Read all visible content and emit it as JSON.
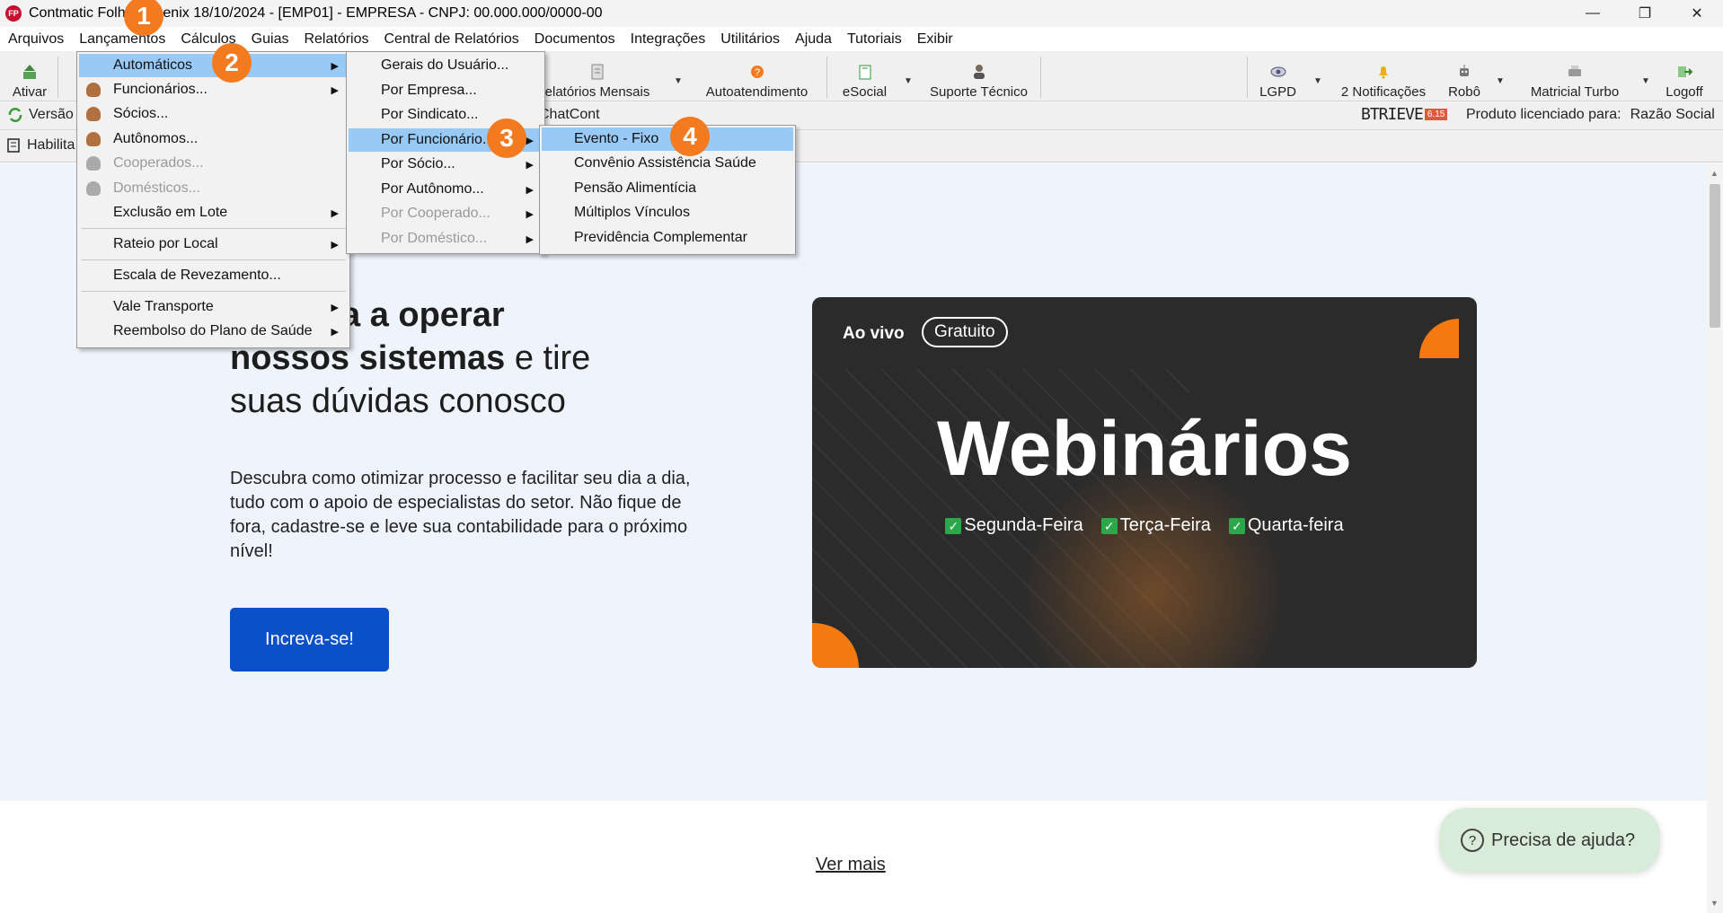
{
  "window": {
    "logo_text": "FP",
    "title": "Contmatic Folha Phoenix 18/10/2024 - [EMP01] - EMPRESA - CNPJ: 00.000.000/0000-00",
    "minimize": "—",
    "maximize": "❐",
    "close": "✕"
  },
  "menubar": [
    "Arquivos",
    "Lançamentos",
    "Cálculos",
    "Guias",
    "Relatórios",
    "Central de Relatórios",
    "Documentos",
    "Integrações",
    "Utilitários",
    "Ajuda",
    "Tutoriais",
    "Exibir"
  ],
  "toolbar": {
    "ativar": "Ativar",
    "relatorios_mensais": "elatórios Mensais",
    "autoatendimento": "Autoatendimento",
    "esocial": "eSocial",
    "suporte": "Suporte Técnico",
    "lgpd": "LGPD",
    "notificacoes": "2 Notificações",
    "robo": "Robô",
    "matricial": "Matricial Turbo",
    "logoff": "Logoff"
  },
  "bar2": {
    "versao": "Versão",
    "chatcont": "ChatCont",
    "btrieve": "BTRIEVE",
    "btrieve_ver": "6.15",
    "licenciado": "Produto licenciado para:",
    "razao": "Razão Social"
  },
  "bar3": {
    "habilita": "Habilita"
  },
  "menu_lancamentos": [
    {
      "label": "Automáticos",
      "state": "selected",
      "submenu": true
    },
    {
      "label": "Funcionários...",
      "icon": "person-icon",
      "submenu": true
    },
    {
      "label": "Sócios...",
      "icon": "person-icon"
    },
    {
      "label": "Autônomos...",
      "icon": "person-icon"
    },
    {
      "label": "Cooperados...",
      "icon": "person-icon",
      "state": "disabled"
    },
    {
      "label": "Domésticos...",
      "icon": "person-icon",
      "state": "disabled"
    },
    {
      "label": "Exclusão em Lote",
      "submenu": true
    },
    {
      "label": "Rateio por Local",
      "submenu": true
    },
    {
      "label": "Escala de Revezamento..."
    },
    {
      "label": "Vale Transporte",
      "submenu": true
    },
    {
      "label": "Reembolso do Plano de Saúde",
      "submenu": true
    }
  ],
  "menu_automaticos": [
    {
      "label": "Gerais do Usuário..."
    },
    {
      "label": "Por Empresa..."
    },
    {
      "label": "Por Sindicato..."
    },
    {
      "label": "Por Funcionário...",
      "state": "selected",
      "submenu": true
    },
    {
      "label": "Por Sócio...",
      "submenu": true
    },
    {
      "label": "Por Autônomo...",
      "submenu": true
    },
    {
      "label": "Por Cooperado...",
      "state": "disabled",
      "submenu": true
    },
    {
      "label": "Por Doméstico...",
      "state": "disabled",
      "submenu": true
    }
  ],
  "menu_por_funcionario": [
    {
      "label": "Evento - Fixo",
      "state": "selected"
    },
    {
      "label": "Convênio Assistência Saúde"
    },
    {
      "label": "Pensão Alimentícia"
    },
    {
      "label": "Múltiplos Vínculos"
    },
    {
      "label": "Previdência Complementar"
    }
  ],
  "hero": {
    "heading_line1": "a a operar",
    "heading_line2_bold": "nossos sistemas",
    "heading_line2_rest": " e tire",
    "heading_line3": "suas dúvidas conosco",
    "paragraph": "Descubra como otimizar processo e facilitar seu dia a dia, tudo com o apoio de especialistas do setor. Não fique de fora, cadastre-se e leve sua contabilidade para o próximo nível!",
    "cta": "Increva-se!"
  },
  "webinar": {
    "ao_vivo": "Ao vivo",
    "gratuito": "Gratuito",
    "title": "Webinários",
    "days": [
      "Segunda-Feira",
      "Terça-Feira",
      "Quarta-feira"
    ],
    "check": "✓"
  },
  "footer": {
    "ver_mais": "Ver mais",
    "help": "Precisa de ajuda?",
    "help_q": "?"
  },
  "badges": [
    "1",
    "2",
    "3",
    "4"
  ],
  "colors": {
    "badge": "#f47a1f",
    "menu_selected": "#99c9f5",
    "cta": "#0a50c7",
    "hero_bg": "#eff4fc"
  }
}
